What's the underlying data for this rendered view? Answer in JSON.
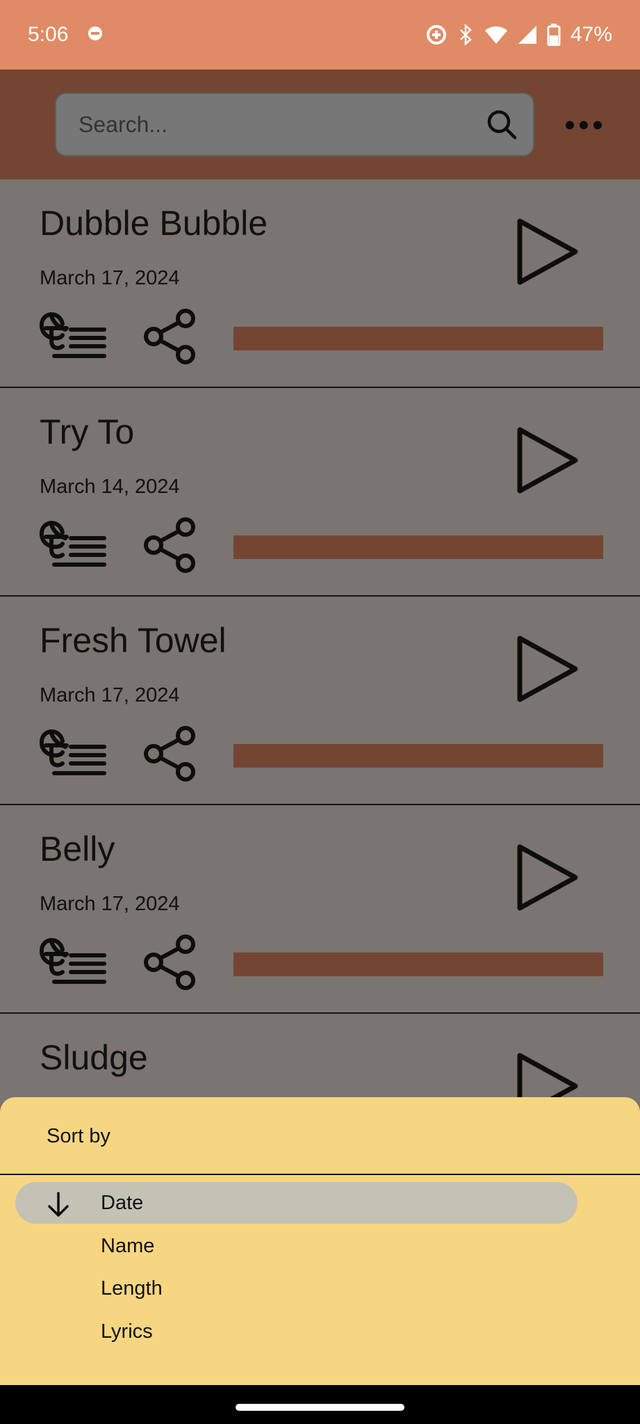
{
  "status_bar": {
    "time": "5:06",
    "battery": "47%",
    "icons": [
      "dnd-icon",
      "data-saver-icon",
      "bluetooth-icon",
      "wifi-icon",
      "cellular-icon",
      "battery-icon"
    ]
  },
  "app_bar": {
    "search_placeholder": "Search...",
    "search_icon": "search-icon",
    "more_icon": "more-horizontal-icon"
  },
  "songs": [
    {
      "title": "Dubble Bubble",
      "date": "March 17, 2024"
    },
    {
      "title": "Try To",
      "date": "March 14, 2024"
    },
    {
      "title": "Fresh Towel",
      "date": "March 17, 2024"
    },
    {
      "title": "Belly",
      "date": "March 17, 2024"
    },
    {
      "title": "Sludge",
      "date": ""
    }
  ],
  "song_progress": [
    1,
    1,
    1,
    1,
    1
  ],
  "sort_sheet": {
    "title": "Sort by",
    "options": [
      {
        "label": "Date",
        "selected": true,
        "direction_icon": "arrow-down-icon"
      },
      {
        "label": "Name",
        "selected": false
      },
      {
        "label": "Length",
        "selected": false
      },
      {
        "label": "Lyrics",
        "selected": false
      }
    ]
  },
  "colors": {
    "status_bar": "#e08b65",
    "app_bar": "#744533",
    "list_background": "#7a7571",
    "accent_brown": "#744533",
    "sheet_background": "#f7d682",
    "selected_option": "#c4c2b5"
  }
}
